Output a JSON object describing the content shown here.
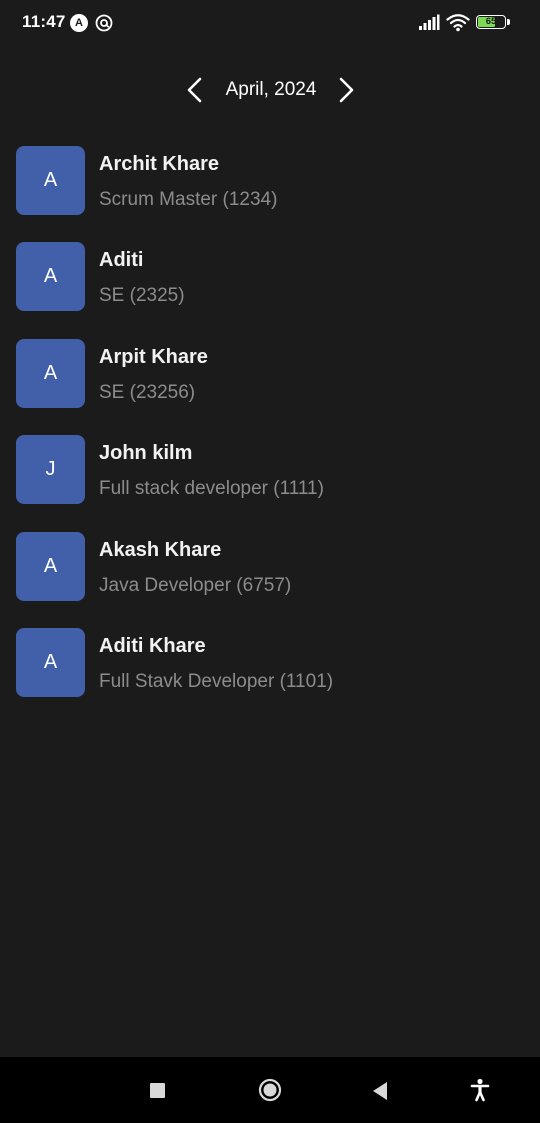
{
  "status_bar": {
    "time": "11:47",
    "icons": [
      "a-circle-icon",
      "at-circle-icon",
      "signal-icon",
      "wifi-icon",
      "battery-icon"
    ],
    "battery_level": "65",
    "battery_fill_percent": 65,
    "battery_color": "#7ed957"
  },
  "month_nav": {
    "label": "April, 2024",
    "prev_icon": "chevron-left-icon",
    "next_icon": "chevron-right-icon"
  },
  "employees": [
    {
      "initial": "A",
      "name": "Archit Khare",
      "role": "Scrum Master (1234)"
    },
    {
      "initial": "A",
      "name": "Aditi",
      "role": "SE (2325)"
    },
    {
      "initial": "A",
      "name": "Arpit Khare",
      "role": "SE (23256)"
    },
    {
      "initial": "J",
      "name": "John kilm",
      "role": "Full stack developer (1111)"
    },
    {
      "initial": "A",
      "name": "Akash Khare",
      "role": "Java Developer (6757)"
    },
    {
      "initial": "A",
      "name": "Aditi Khare",
      "role": "Full Stavk Developer (1101)"
    }
  ],
  "colors": {
    "background": "#1b1b1c",
    "avatar": "#4260a9",
    "name_text": "#f2f2f2",
    "role_text": "#8c8c8c"
  },
  "system_nav": {
    "icons": [
      "recents-square-icon",
      "home-circle-icon",
      "back-triangle-icon",
      "accessibility-icon"
    ]
  }
}
